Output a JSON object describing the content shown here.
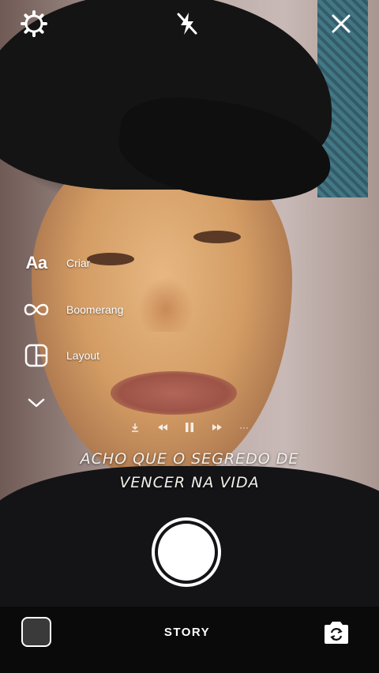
{
  "top_bar": {
    "settings_icon": "gear-icon",
    "flash_icon": "flash-off-icon",
    "close_icon": "close-icon"
  },
  "modes": {
    "items": [
      {
        "label": "Criar",
        "icon_text": "Aa",
        "icon": "text-create-icon"
      },
      {
        "label": "Boomerang",
        "icon": "infinity-icon"
      },
      {
        "label": "Layout",
        "icon": "layout-grid-icon"
      }
    ],
    "more_icon": "chevron-down-icon"
  },
  "media": {
    "controls": [
      "download-icon",
      "rewind-icon",
      "pause-icon",
      "fast-forward-icon",
      "more-icon"
    ],
    "more_text": "···",
    "lyrics": [
      "ACHO QUE O SEGREDO DE",
      "VENCER NA VIDA"
    ]
  },
  "bottom_bar": {
    "gallery_icon": "gallery-thumbnail",
    "mode_label": "STORY",
    "flip_icon": "camera-flip-icon"
  },
  "colors": {
    "overlay_text": "#ffffff",
    "bottom_bar": "#0a0a0a"
  }
}
